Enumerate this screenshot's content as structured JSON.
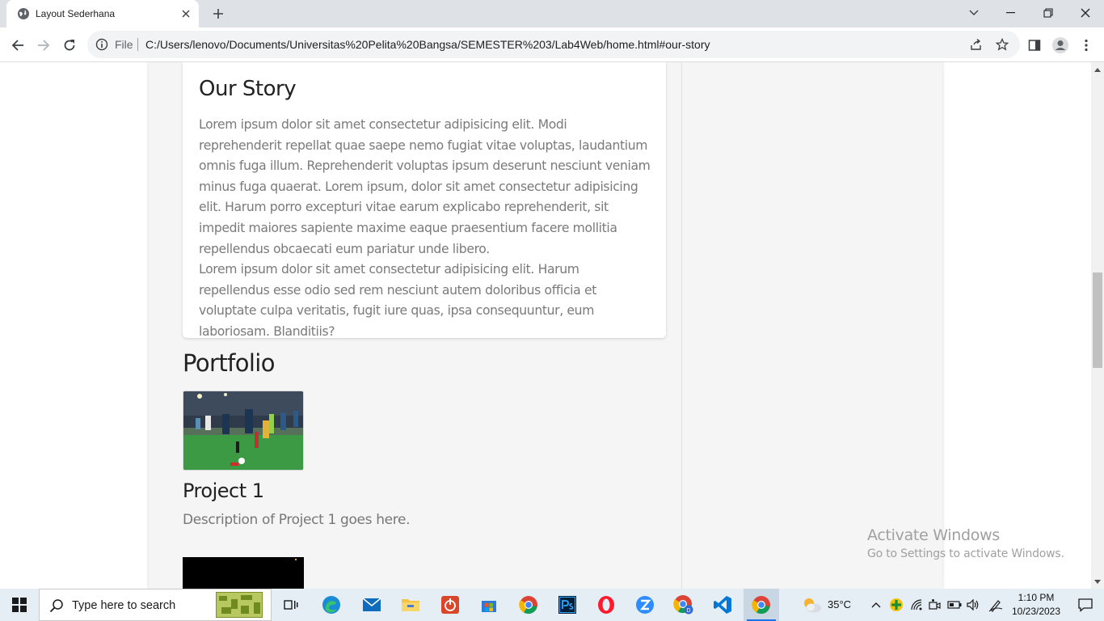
{
  "browser": {
    "tab": {
      "title": "Layout Sederhana",
      "favicon": "globe-icon"
    },
    "omnibox": {
      "scheme_label": "File",
      "url": "C:/Users/lenovo/Documents/Universitas%20Pelita%20Bangsa/SEMESTER%203/Lab4Web/home.html#our-story"
    }
  },
  "page": {
    "our_story": {
      "title": "Our Story",
      "paragraph_1": "Lorem ipsum dolor sit amet consectetur adipisicing elit. Modi reprehenderit repellat quae saepe nemo fugiat vitae voluptas, laudantium omnis fuga illum. Reprehenderit voluptas ipsum deserunt nesciunt veniam minus fuga quaerat. Lorem ipsum, dolor sit amet consectetur adipisicing elit. Harum porro excepturi vitae earum explicabo reprehenderit, sit impedit maiores sapiente maxime eaque praesentium facere mollitia repellendus obcaecati eum pariatur unde libero.",
      "paragraph_2": "Lorem ipsum dolor sit amet consectetur adipisicing elit. Harum repellendus esse odio sed rem nesciunt autem doloribus officia et voluptate culpa veritatis, fugit iure quas, ipsa consequuntur, eum laboriosam. Blanditiis?"
    },
    "portfolio": {
      "title": "Portfolio",
      "projects": [
        {
          "title": "Project 1",
          "description": "Description of Project 1 goes here.",
          "image": "soccer-match-photo"
        },
        {
          "image": "dark-photo"
        }
      ]
    }
  },
  "watermark": {
    "line1": "Activate Windows",
    "line2": "Go to Settings to activate Windows."
  },
  "taskbar": {
    "search_placeholder": "Type here to search",
    "weather_temp": "35°C",
    "time": "1:10 PM",
    "date": "10/23/2023",
    "apps": [
      "task-view",
      "edge",
      "mail",
      "file-explorer",
      "app-red",
      "microsoft-store",
      "chrome",
      "photoshop",
      "opera",
      "zoom",
      "chrome-profile",
      "vscode",
      "chrome-active"
    ]
  },
  "colors": {
    "tabstrip": "#dee1e6",
    "page_background": "#f5f5f5",
    "taskbar": "#e5eef5",
    "accent": "#1a73e8"
  }
}
